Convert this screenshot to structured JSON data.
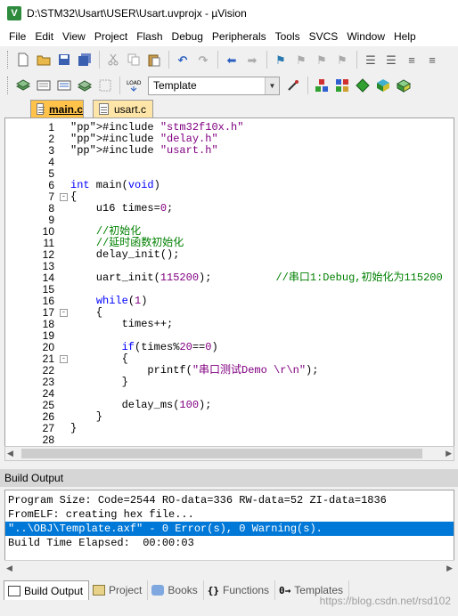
{
  "window": {
    "title": "D:\\STM32\\Usart\\USER\\Usart.uvprojx - µVision",
    "icon": "uvision-app-icon"
  },
  "menu": [
    "File",
    "Edit",
    "View",
    "Project",
    "Flash",
    "Debug",
    "Peripherals",
    "Tools",
    "SVCS",
    "Window",
    "Help"
  ],
  "toolbar": {
    "target_label": "Template"
  },
  "tabs": [
    {
      "label": "main.c",
      "active": true
    },
    {
      "label": "usart.c",
      "active": false
    }
  ],
  "editor": {
    "lines": [
      {
        "n": "1",
        "t": "#include \"stm32f10x.h\""
      },
      {
        "n": "2",
        "t": "#include \"delay.h\""
      },
      {
        "n": "3",
        "t": "#include \"usart.h\""
      },
      {
        "n": "4",
        "t": ""
      },
      {
        "n": "5",
        "t": ""
      },
      {
        "n": "6",
        "t": "int main(void)"
      },
      {
        "n": "7",
        "t": "{"
      },
      {
        "n": "8",
        "t": "    u16 times=0;"
      },
      {
        "n": "9",
        "t": ""
      },
      {
        "n": "10",
        "t": "    //初始化"
      },
      {
        "n": "11",
        "t": "    //延时函数初始化"
      },
      {
        "n": "12",
        "t": "    delay_init();"
      },
      {
        "n": "13",
        "t": ""
      },
      {
        "n": "14",
        "t": "    uart_init(115200);          //串口1:Debug,初始化为115200"
      },
      {
        "n": "15",
        "t": ""
      },
      {
        "n": "16",
        "t": "    while(1)"
      },
      {
        "n": "17",
        "t": "    {"
      },
      {
        "n": "18",
        "t": "        times++;"
      },
      {
        "n": "19",
        "t": ""
      },
      {
        "n": "20",
        "t": "        if(times%20==0)"
      },
      {
        "n": "21",
        "t": "        {"
      },
      {
        "n": "22",
        "t": "            printf(\"串口测试Demo \\r\\n\");"
      },
      {
        "n": "23",
        "t": "        }"
      },
      {
        "n": "24",
        "t": ""
      },
      {
        "n": "25",
        "t": "        delay_ms(100);"
      },
      {
        "n": "26",
        "t": "    }"
      },
      {
        "n": "27",
        "t": "}"
      },
      {
        "n": "28",
        "t": ""
      }
    ]
  },
  "build_output": {
    "title": "Build Output",
    "lines": [
      "Program Size: Code=2544 RO-data=336 RW-data=52 ZI-data=1836",
      "FromELF: creating hex file...",
      "\"..\\OBJ\\Template.axf\" - 0 Error(s), 0 Warning(s).",
      "Build Time Elapsed:  00:00:03"
    ],
    "selected_index": 2
  },
  "bottom_tabs": [
    {
      "label": "Build Output",
      "active": true
    },
    {
      "label": "Project",
      "active": false
    },
    {
      "label": "Books",
      "active": false
    },
    {
      "label": "Functions",
      "active": false
    },
    {
      "label": "Templates",
      "active": false
    }
  ],
  "watermark": "https://blog.csdn.net/rsd102",
  "colors": {
    "tab_active": "#ffc24a",
    "tab_inactive": "#ffe6a8",
    "selection": "#0078d7",
    "keyword": "#0000ff",
    "comment": "#008000",
    "string": "#800080"
  }
}
